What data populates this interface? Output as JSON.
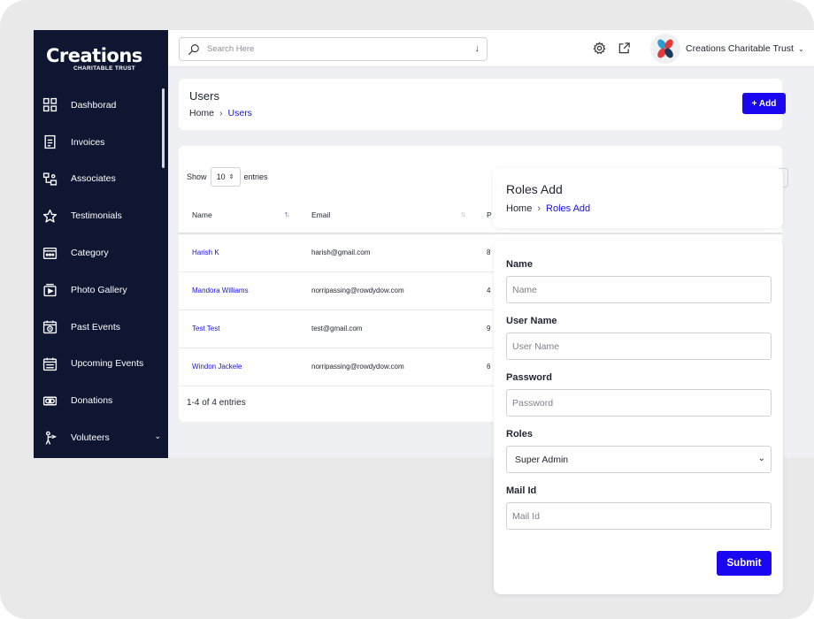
{
  "sidebar": {
    "logo": {
      "main": "Creations",
      "sub": "CHARITABLE TRUST"
    },
    "items": [
      {
        "label": "Dashborad",
        "icon": "dashboard-icon"
      },
      {
        "label": "Invoices",
        "icon": "invoice-icon"
      },
      {
        "label": "Associates",
        "icon": "associates-icon"
      },
      {
        "label": "Testimonials",
        "icon": "star-icon"
      },
      {
        "label": "Category",
        "icon": "category-icon"
      },
      {
        "label": "Photo Gallery",
        "icon": "gallery-icon"
      },
      {
        "label": "Past Events",
        "icon": "calendar-clock-icon"
      },
      {
        "label": "Upcoming Events",
        "icon": "calendar-list-icon"
      },
      {
        "label": "Donations",
        "icon": "money-icon"
      },
      {
        "label": "Voluteers",
        "icon": "volunteer-icon",
        "has_children": true
      }
    ]
  },
  "topbar": {
    "search_placeholder": "Search Here",
    "org_name": "Creations Charitable Trust"
  },
  "users_page": {
    "title": "Users",
    "breadcrumb": {
      "home": "Home",
      "current": "Users"
    },
    "add_label": "+ Add"
  },
  "table": {
    "show_label": "Show",
    "page_size": "10",
    "entries_label": "entries",
    "columns": [
      "Name",
      "Email",
      "P"
    ],
    "rows": [
      {
        "name": "Harish K",
        "email": "harish@gmail.com",
        "p": "8"
      },
      {
        "name": "Mandora Williams",
        "email": "norripassing@rowdydow.com",
        "p": "4"
      },
      {
        "name": "Test Test",
        "email": "test@gmail.com",
        "p": "9"
      },
      {
        "name": "Windon Jackele",
        "email": "norripassing@rowdydow.com",
        "p": "6"
      }
    ],
    "footer": "1-4 of 4 entries"
  },
  "roles_add": {
    "title": "Roles Add",
    "breadcrumb": {
      "home": "Home",
      "current": "Roles Add"
    },
    "fields": {
      "name": {
        "label": "Name",
        "placeholder": "Name"
      },
      "username": {
        "label": "User Name",
        "placeholder": "User Name"
      },
      "password": {
        "label": "Password",
        "placeholder": "Password"
      },
      "roles": {
        "label": "Roles",
        "value": "Super Admin"
      },
      "mail": {
        "label": "Mail Id",
        "placeholder": "Mail Id"
      }
    },
    "submit_label": "Submit"
  },
  "colors": {
    "sidebar_bg": "#0f1631",
    "primary": "#1a06f0",
    "link": "#1a10e8"
  }
}
